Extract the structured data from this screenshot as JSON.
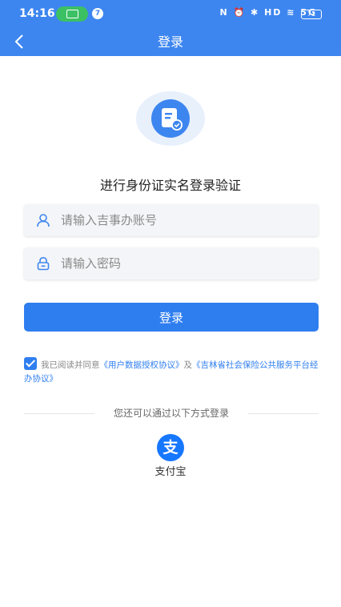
{
  "status_bar": {
    "time": "14:16",
    "notification_count": "7",
    "system_icons_text": "N ⏰ ✱ HD ≋ 5G",
    "battery": "71"
  },
  "nav": {
    "title": "登录"
  },
  "verify_title": "进行身份证实名登录验证",
  "account_input": {
    "placeholder": "请输入吉事办账号",
    "value": ""
  },
  "password_input": {
    "placeholder": "请输入密码",
    "value": ""
  },
  "login_button": "登录",
  "agreement": {
    "checked": true,
    "prefix": "我已阅读并同意",
    "link1": "《用户数据授权协议》",
    "middle": "及",
    "link2": "《吉林省社会保险公共服务平台经办协议》"
  },
  "alt_login": {
    "divider_text": "您还可以通过以下方式登录",
    "alipay_icon_text": "支",
    "alipay_label": "支付宝"
  },
  "colors": {
    "header_bg": "#3d86f0",
    "primary": "#2f7ef0",
    "alipay": "#1677ff"
  }
}
